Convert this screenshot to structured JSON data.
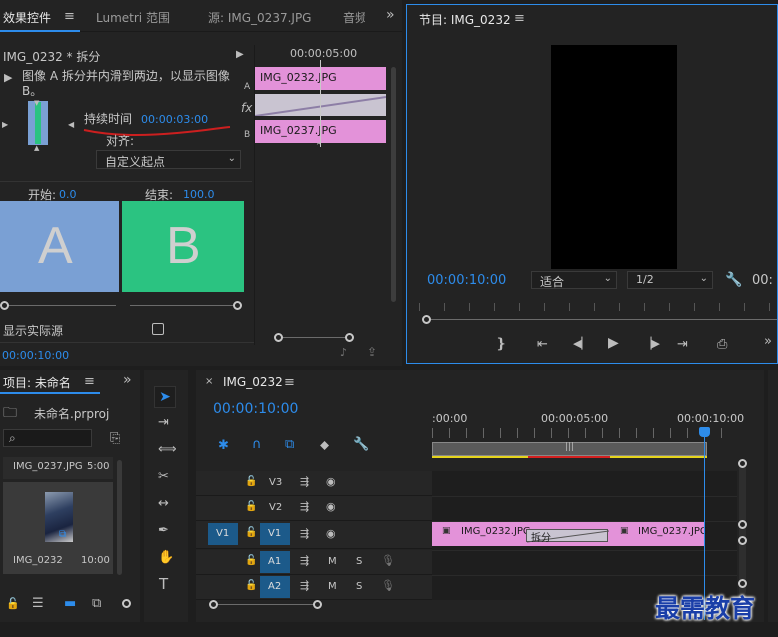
{
  "effect_controls": {
    "tab_effect": "效果控件",
    "tab_lumetri": "Lumetri 范围",
    "tab_source": "源: IMG_0237.JPG",
    "tab_audio": "音频",
    "clip_header": "IMG_0232 * 拆分",
    "ruler_time": "00:00:05:00",
    "description": "图像 A 拆分并内滑到两边，以显示图像 B。",
    "duration_label": "持续时间",
    "duration_value": "00:00:03:00",
    "align_label": "对齐:",
    "align_value": "自定义起点",
    "start_label": "开始:",
    "start_value": "0.0",
    "end_label": "结束:",
    "end_value": "100.0",
    "preview_a": "A",
    "preview_b": "B",
    "show_actual_sources": "显示实际源",
    "current_time": "00:00:10:00",
    "track_a_letter": "A",
    "track_b_letter": "B",
    "fx_label": "fx",
    "clip_a_name": "IMG_0232.JPG",
    "clip_b_name": "IMG_0237.JPG"
  },
  "program": {
    "title": "节目: IMG_0232",
    "timecode": "00:00:10:00",
    "fit": "适合",
    "resolution": "1/2",
    "timecode_right": "00:"
  },
  "project": {
    "title": "项目: 未命名",
    "project_file": "未命名.prproj",
    "item1_name": "IMG_0237.JPG",
    "item1_duration": "5:00",
    "item2_name": "IMG_0232",
    "item2_duration": "10:00"
  },
  "timeline": {
    "title": "IMG_0232",
    "timecode": "00:00:10:00",
    "ruler_labels": [
      ":00:00",
      "00:00:05:00",
      "00:00:10:00"
    ],
    "tracks": {
      "v3": "V3",
      "v2": "V2",
      "v1": "V1",
      "v1_source": "V1",
      "a1": "A1",
      "a2": "A2",
      "mute": "M",
      "solo": "S"
    },
    "clip_a": "IMG_0232.JPG",
    "transition": "拆分",
    "clip_b": "IMG_0237.JPG"
  },
  "watermark": "最需教育",
  "colors": {
    "accent_blue": "#2d8ceb",
    "clip_pink": "#e392d9",
    "preview_a": "#7aa0d4",
    "preview_b": "#2bc381",
    "panel_bg": "#232323"
  }
}
